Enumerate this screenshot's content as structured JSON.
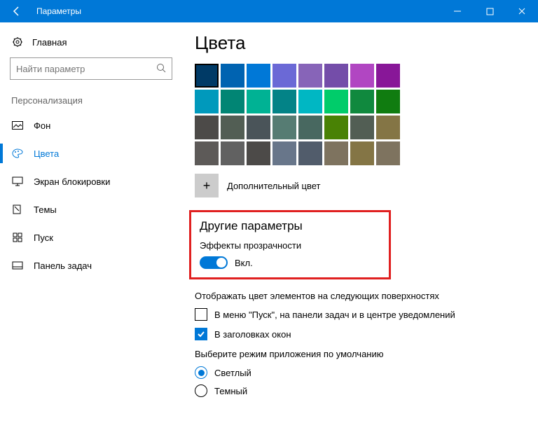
{
  "titlebar": {
    "title": "Параметры"
  },
  "sidebar": {
    "home": "Главная",
    "search_placeholder": "Найти параметр",
    "section": "Персонализация",
    "items": [
      {
        "label": "Фон"
      },
      {
        "label": "Цвета"
      },
      {
        "label": "Экран блокировки"
      },
      {
        "label": "Темы"
      },
      {
        "label": "Пуск"
      },
      {
        "label": "Панель задач"
      }
    ]
  },
  "content": {
    "heading": "Цвета",
    "colors_row1": [
      "#003a66",
      "#0063b1",
      "#0078d7",
      "#6b69d6",
      "#8764b8",
      "#744da9",
      "#b146c2",
      "#881798"
    ],
    "colors_row2": [
      "#0099bc",
      "#018574",
      "#00b294",
      "#038387",
      "#00b7c3",
      "#00cc6a",
      "#10893e",
      "#107c10"
    ],
    "colors_row3": [
      "#4c4a48",
      "#525e54",
      "#4a5459",
      "#567c73",
      "#486860",
      "#498205",
      "#525e54",
      "#847545"
    ],
    "colors_row4": [
      "#5d5a58",
      "#616161",
      "#4c4a48",
      "#68768a",
      "#515c6b",
      "#7e735f",
      "#847545",
      "#7e735f"
    ],
    "selected_index": 0,
    "add_color": "Дополнительный цвет",
    "more_heading": "Другие параметры",
    "transparency_label": "Эффекты прозрачности",
    "toggle_on": "Вкл.",
    "surfaces_label": "Отображать цвет элементов на следующих поверхностях",
    "chk_start": "В меню \"Пуск\", на панели задач и в центре уведомлений",
    "chk_titlebars": "В заголовках окон",
    "mode_label": "Выберите режим приложения по умолчанию",
    "mode_light": "Светлый",
    "mode_dark": "Темный"
  }
}
